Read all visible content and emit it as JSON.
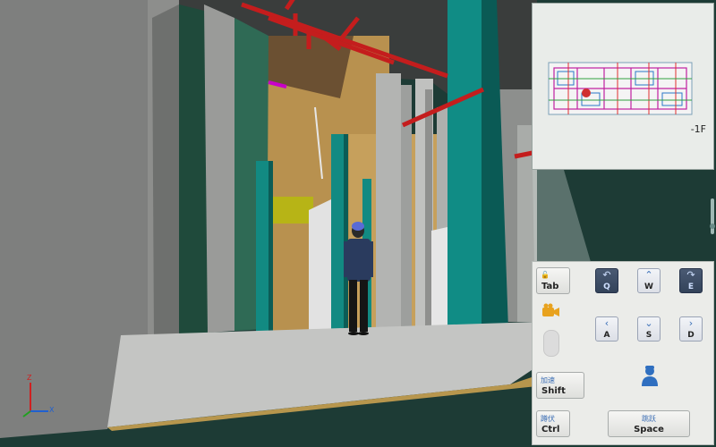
{
  "minimap": {
    "floor": "-1F"
  },
  "axis": {
    "x": "X",
    "z": "Z"
  },
  "controls": {
    "tab": {
      "main": "Tab"
    },
    "q": {
      "letter": "Q"
    },
    "w": {
      "letter": "W"
    },
    "e": {
      "letter": "E"
    },
    "a": {
      "letter": "A"
    },
    "s": {
      "letter": "S"
    },
    "d": {
      "letter": "D"
    },
    "shift": {
      "small": "加速",
      "main": "Shift"
    },
    "ctrl": {
      "small": "蹲伏",
      "main": "Ctrl"
    },
    "space": {
      "small": "跳跃",
      "main": "Space"
    }
  },
  "colors": {
    "teal_column": "#0f8a82",
    "pipe_red": "#c0201f",
    "wall_tan": "#b58b4e",
    "floor_gray": "#c9c9c9"
  }
}
